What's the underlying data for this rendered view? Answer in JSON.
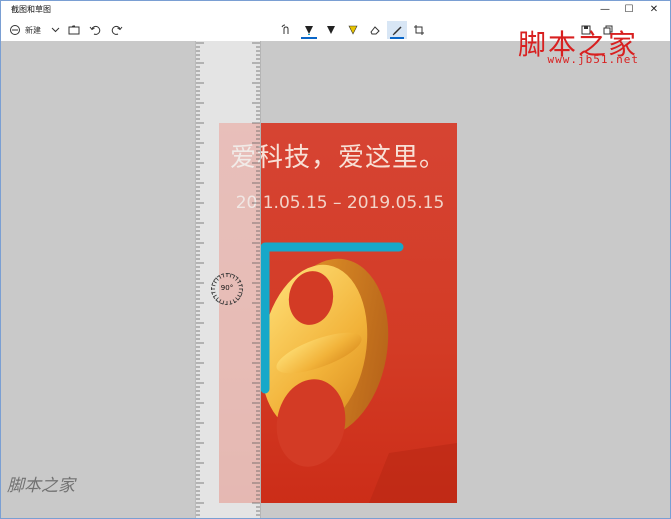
{
  "window": {
    "title": "截图和草图",
    "controls": {
      "minimize": "—",
      "maximize": "☐",
      "close": "✕"
    }
  },
  "toolbar": {
    "new_label": "新建",
    "more_label": "···"
  },
  "poster": {
    "headline": "爱科技，爱这里。",
    "dates": "20  1.05.15 – 2019.05.15",
    "number": "8"
  },
  "protractor": {
    "label": "90°"
  },
  "watermark": {
    "title": "脚本之家",
    "url": "www.jb51.net",
    "bottom": "脚本之家"
  },
  "colors": {
    "poster_red": "#d33b25",
    "highlight_blue": "#16a8c9",
    "accent": "#0a66c8"
  }
}
